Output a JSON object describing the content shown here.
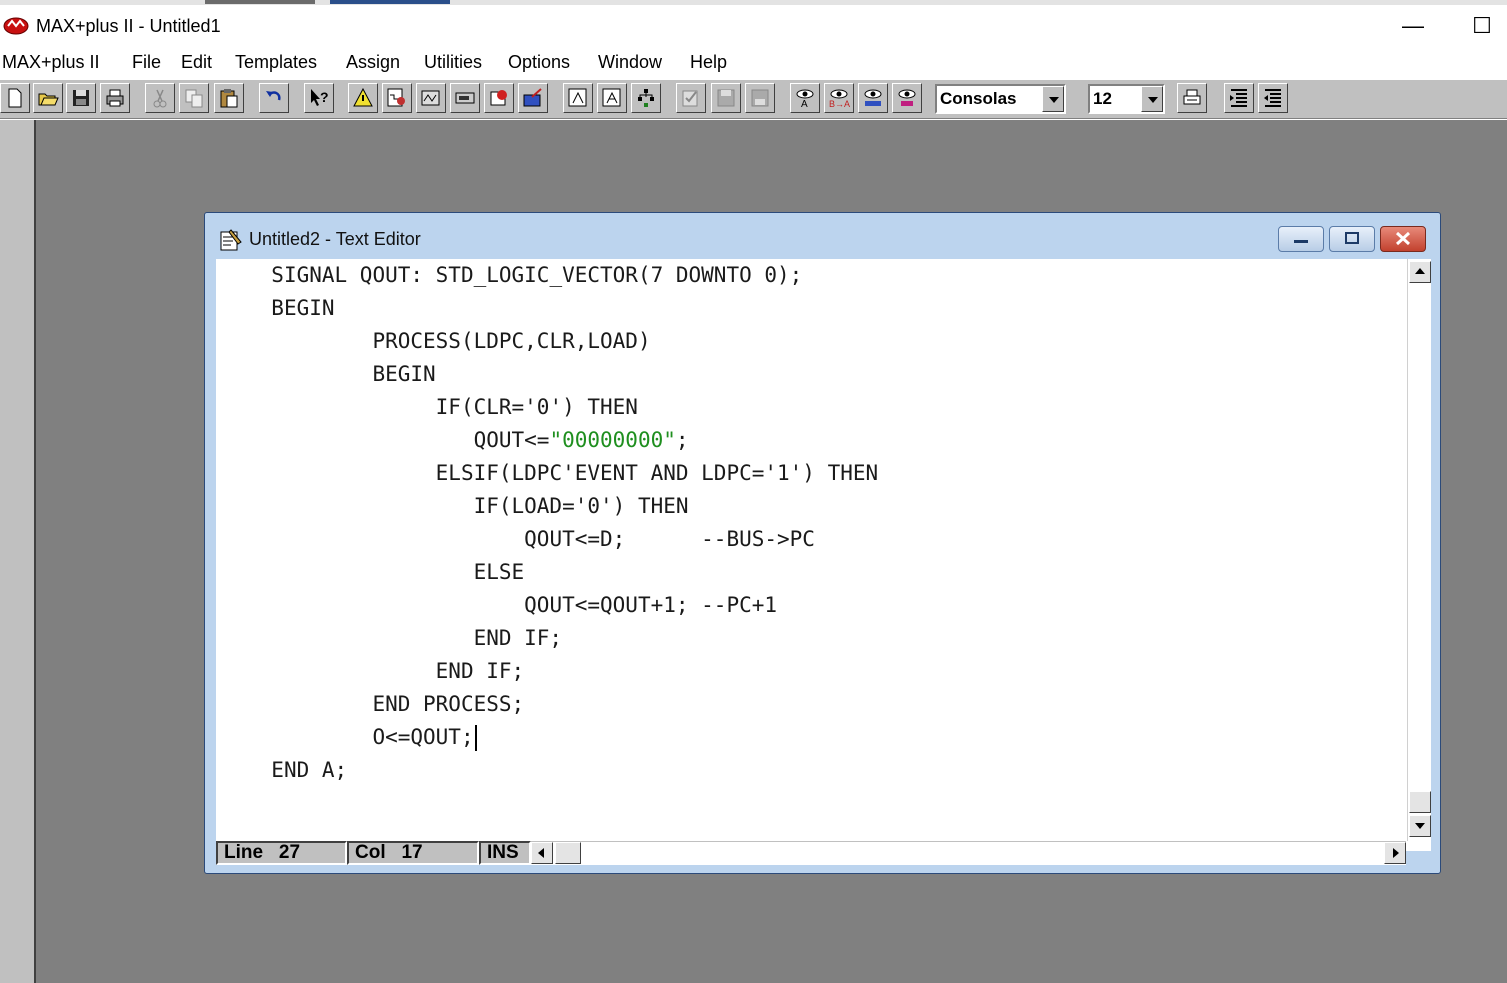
{
  "app": {
    "title": "MAX+plus II - Untitled1",
    "minimize_glyph": "—",
    "maximize_glyph": "☐"
  },
  "menu": [
    "MAX+plus II",
    "File",
    "Edit",
    "Templates",
    "Assign",
    "Utilities",
    "Options",
    "Window",
    "Help"
  ],
  "toolbar": {
    "font_name": "Consolas",
    "font_size": "12",
    "icons": [
      "new-file-icon",
      "open-file-icon",
      "save-icon",
      "print-icon",
      "cut-icon",
      "copy-icon",
      "paste-icon",
      "undo-icon",
      "context-help-icon",
      "compiler-icon",
      "simulator-icon",
      "timing-analyzer-icon",
      "programmer-icon",
      "floorplan-icon",
      "hierarchy-icon",
      "open-hierarchy-icon",
      "hierarchy-down-icon",
      "hierarchy-tree-icon",
      "check-icon",
      "save-check-icon",
      "save-compile-icon",
      "find-icon",
      "replace-icon",
      "find-text-icon",
      "find-node-icon",
      "print-setup-icon",
      "indent-icon",
      "outdent-icon"
    ]
  },
  "editor": {
    "title": "Untitled2 - Text Editor",
    "code_lines": [
      {
        "indent": "  ",
        "text": "SIGNAL QOUT: STD_LOGIC_VECTOR(7 DOWNTO 0);"
      },
      {
        "indent": "  ",
        "text": "BEGIN"
      },
      {
        "indent": "          ",
        "text": "PROCESS(LDPC,CLR,LOAD)"
      },
      {
        "indent": "          ",
        "text": "BEGIN"
      },
      {
        "indent": "               ",
        "text": "IF(CLR='0') THEN"
      },
      {
        "indent": "                  ",
        "pre": "QOUT<=",
        "str": "\"00000000\"",
        "post": ";"
      },
      {
        "indent": "               ",
        "text": "ELSIF(LDPC'EVENT AND LDPC='1') THEN"
      },
      {
        "indent": "                  ",
        "text": "IF(LOAD='0') THEN"
      },
      {
        "indent": "                      ",
        "text": "QOUT<=D;      --BUS->PC"
      },
      {
        "indent": "                  ",
        "text": "ELSE"
      },
      {
        "indent": "                      ",
        "text": "QOUT<=QOUT+1; --PC+1"
      },
      {
        "indent": "                  ",
        "text": "END IF;"
      },
      {
        "indent": "               ",
        "text": "END IF;"
      },
      {
        "indent": "          ",
        "text": "END PROCESS;"
      },
      {
        "indent": "          ",
        "text": "O<=QOUT;",
        "caret": true
      },
      {
        "indent": "  ",
        "text": "END A;"
      }
    ],
    "status": {
      "line_label": "Line",
      "line_value": "27",
      "col_label": "Col",
      "col_value": "17",
      "mode": "INS"
    }
  }
}
